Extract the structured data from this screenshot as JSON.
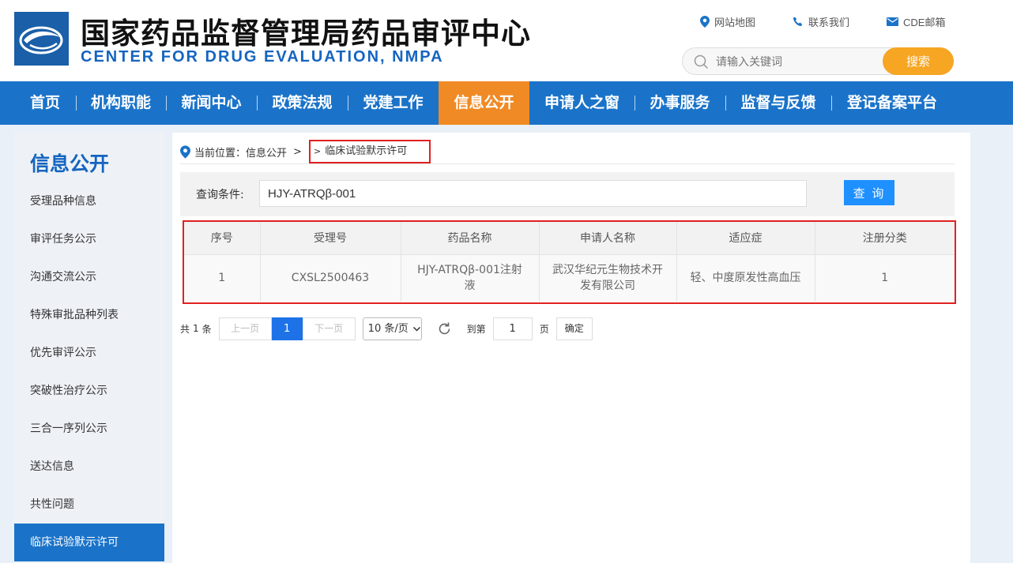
{
  "header": {
    "title_cn": "国家药品监督管理局药品审评中心",
    "title_en": "CENTER FOR DRUG EVALUATION, NMPA",
    "top_links": [
      {
        "label": "网站地图",
        "icon": "map-pin-icon"
      },
      {
        "label": "联系我们",
        "icon": "phone-icon"
      },
      {
        "label": "CDE邮箱",
        "icon": "mail-icon"
      }
    ],
    "search": {
      "placeholder": "请输入关键词",
      "button": "搜索"
    }
  },
  "nav": {
    "items": [
      {
        "label": "首页"
      },
      {
        "label": "机构职能"
      },
      {
        "label": "新闻中心"
      },
      {
        "label": "政策法规"
      },
      {
        "label": "党建工作"
      },
      {
        "label": "信息公开",
        "active": true
      },
      {
        "label": "申请人之窗"
      },
      {
        "label": "办事服务"
      },
      {
        "label": "监督与反馈"
      },
      {
        "label": "登记备案平台"
      }
    ]
  },
  "sidebar": {
    "title": "信息公开",
    "items": [
      {
        "label": "受理品种信息"
      },
      {
        "label": "审评任务公示"
      },
      {
        "label": "沟通交流公示"
      },
      {
        "label": "特殊审批品种列表"
      },
      {
        "label": "优先审评公示"
      },
      {
        "label": "突破性治疗公示"
      },
      {
        "label": "三合一序列公示"
      },
      {
        "label": "送达信息"
      },
      {
        "label": "共性问题"
      },
      {
        "label": "临床试验默示许可",
        "active": true
      }
    ]
  },
  "breadcrumb": {
    "prefix": "当前位置：",
    "parent": "信息公开",
    "sep": ">",
    "current_sep": ">",
    "current": "临床试验默示许可"
  },
  "query": {
    "label": "查询条件:",
    "value": "HJY-ATRQβ-001",
    "button": "查 询"
  },
  "table": {
    "headers": [
      "序号",
      "受理号",
      "药品名称",
      "申请人名称",
      "适应症",
      "注册分类"
    ],
    "rows": [
      [
        "1",
        "CXSL2500463",
        "HJY-ATRQβ-001注射液",
        "武汉华纪元生物技术开发有限公司",
        "轻、中度原发性高血压",
        "1"
      ]
    ]
  },
  "pagination": {
    "total_prefix": "共",
    "total": "1",
    "total_suffix": "条",
    "prev": "上一页",
    "current_page": "1",
    "next": "下一页",
    "page_size": "10 条/页",
    "goto_label": "到第",
    "goto_value": "1",
    "page_unit": "页",
    "confirm": "确定"
  },
  "colors": {
    "primary": "#1a73c9",
    "accent": "#f08a24",
    "search_button": "#f6a623",
    "highlight_border": "#e02020"
  }
}
